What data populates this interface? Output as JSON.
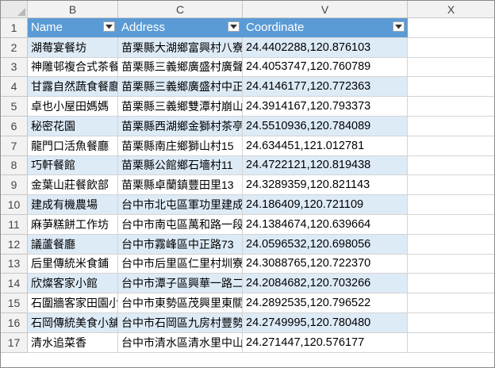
{
  "columns": [
    "B",
    "C",
    "V",
    "X"
  ],
  "table": {
    "headers": [
      "Name",
      "Address",
      "Coordinate"
    ],
    "rows": [
      {
        "num": "1"
      },
      {
        "num": "2",
        "name": "湖莓宴餐坊",
        "address": "苗栗縣大湖鄉富興村八寮灣",
        "coord": "24.4402288,120.876103"
      },
      {
        "num": "3",
        "name": "神雕邨複合式茶餐廳",
        "address": "苗栗縣三義鄉廣盛村廣聲新城",
        "coord": "24.4053747,120.760789"
      },
      {
        "num": "4",
        "name": "甘露自然蔬食餐廳",
        "address": "苗栗縣三義鄉廣盛村中正路",
        "coord": "24.4146177,120.772363"
      },
      {
        "num": "5",
        "name": "卓也小屋田媽媽",
        "address": "苗栗縣三義鄉雙潭村崩山下",
        "coord": "24.3914167,120.793373"
      },
      {
        "num": "6",
        "name": "秘密花園",
        "address": "苗栗縣西湖鄉金獅村茶亭",
        "coord": "24.5510936,120.784089"
      },
      {
        "num": "7",
        "name": "龍門口活魚餐廳",
        "address": "苗栗縣南庄鄉獅山村15",
        "coord": "24.634451,121.012781"
      },
      {
        "num": "8",
        "name": "巧軒餐館",
        "address": "苗栗縣公館鄉石墻村11",
        "coord": "24.4722121,120.819438"
      },
      {
        "num": "9",
        "name": "金葉山莊餐飲部",
        "address": "苗栗縣卓蘭鎮豐田里13",
        "coord": "24.3289359,120.821143"
      },
      {
        "num": "10",
        "name": "建成有機農場",
        "address": "台中市北屯區軍功里建成路",
        "coord": "24.186409,120.721109"
      },
      {
        "num": "11",
        "name": "麻芛糕餅工作坊",
        "address": "台中市南屯區萬和路一段",
        "coord": "24.1384674,120.639664"
      },
      {
        "num": "12",
        "name": "議蘆餐廳",
        "address": "台中市霧峰區中正路73",
        "coord": "24.0596532,120.698056"
      },
      {
        "num": "13",
        "name": "后里傳統米食鋪",
        "address": "台中市后里區仁里村圳寮",
        "coord": "24.3088765,120.722370"
      },
      {
        "num": "14",
        "name": "欣燦客家小館",
        "address": "台中市潭子區興華一路二段",
        "coord": "24.2084682,120.703266"
      },
      {
        "num": "15",
        "name": "石圍牆客家田園小館",
        "address": "台中市東勢區茂興里東關路",
        "coord": "24.2892535,120.796522"
      },
      {
        "num": "16",
        "name": "石岡傳統美食小舖",
        "address": "台中市石岡區九房村豐勢路",
        "coord": "24.2749995,120.780480"
      },
      {
        "num": "17",
        "name": "清水追菜香",
        "address": "台中市清水區清水里中山路",
        "coord": "24.271447,120.576177"
      }
    ]
  },
  "colors": {
    "header_fill": "#5b9bd5",
    "band_fill": "#ddebf7",
    "header_text": "#ffffff"
  },
  "icons": {
    "filter": "filter-dropdown-icon",
    "select_all": "select-all-triangle-icon"
  }
}
